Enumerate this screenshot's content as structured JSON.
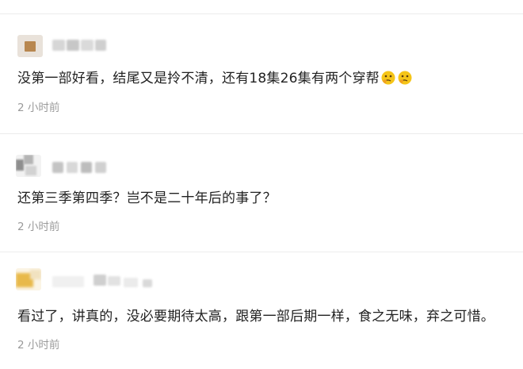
{
  "comments": [
    {
      "text": "没第一部好看，结尾又是拎不清，还有18集26集有两个穿帮",
      "timestamp": "2 小时前",
      "emojis": [
        "thinking-emoji",
        "thinking-emoji"
      ]
    },
    {
      "text": "还第三季第四季？岂不是二十年后的事了？",
      "timestamp": "2 小时前"
    },
    {
      "text": "看过了，讲真的，没必要期待太高，跟第一部后期一样，食之无味，弃之可惜。",
      "timestamp": "2 小时前"
    }
  ],
  "colors": {
    "text": "#222222",
    "timestamp": "#9a9a9a",
    "divider": "#ececec",
    "emoji": "#f5c518"
  }
}
